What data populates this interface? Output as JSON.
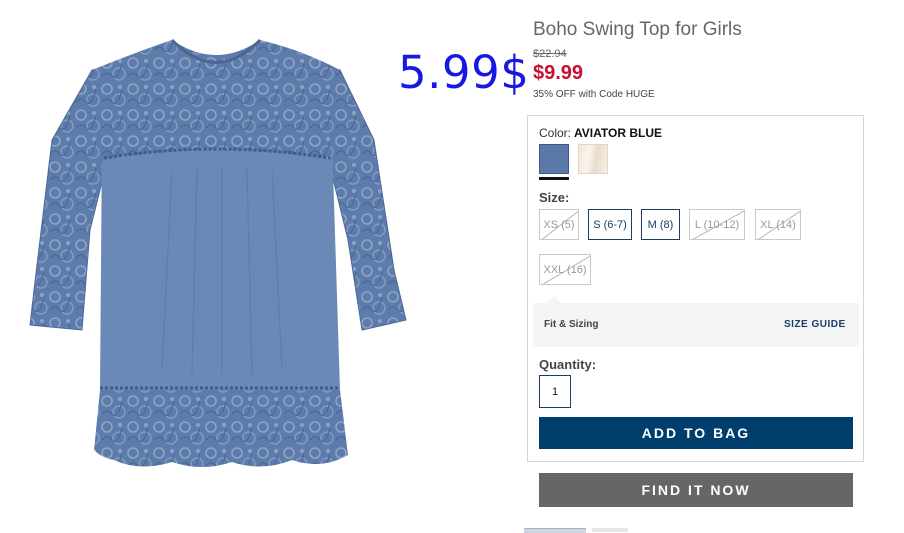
{
  "product": {
    "title": "Boho Swing Top for Girls",
    "original_price": "$22.94",
    "sale_price": "$9.99",
    "promo": "35% OFF with Code HUGE",
    "overlay_price": "5.99$"
  },
  "color": {
    "label": "Color:",
    "selected_name": "AVIATOR BLUE",
    "swatches": [
      {
        "name": "aviator-blue",
        "hex": "#5a78a8",
        "selected": true
      },
      {
        "name": "cream",
        "hex": "#f3e8dc",
        "selected": false
      }
    ]
  },
  "size": {
    "label": "Size:",
    "options": [
      {
        "label": "XS (5)",
        "available": false
      },
      {
        "label": "S (6-7)",
        "available": true
      },
      {
        "label": "M (8)",
        "available": true
      },
      {
        "label": "L (10-12)",
        "available": false
      },
      {
        "label": "XL (14)",
        "available": false
      },
      {
        "label": "XXL (16)",
        "available": false
      }
    ]
  },
  "fit": {
    "label": "Fit & Sizing",
    "guide_link": "SIZE GUIDE"
  },
  "quantity": {
    "label": "Quantity:",
    "value": "1"
  },
  "actions": {
    "add_to_bag": "ADD TO BAG",
    "find_it_now": "FIND IT NOW"
  },
  "colors": {
    "accent_navy": "#003e6e",
    "sale_red": "#c8102e",
    "overlay_blue": "#1717e6",
    "button_gray": "#666666"
  }
}
